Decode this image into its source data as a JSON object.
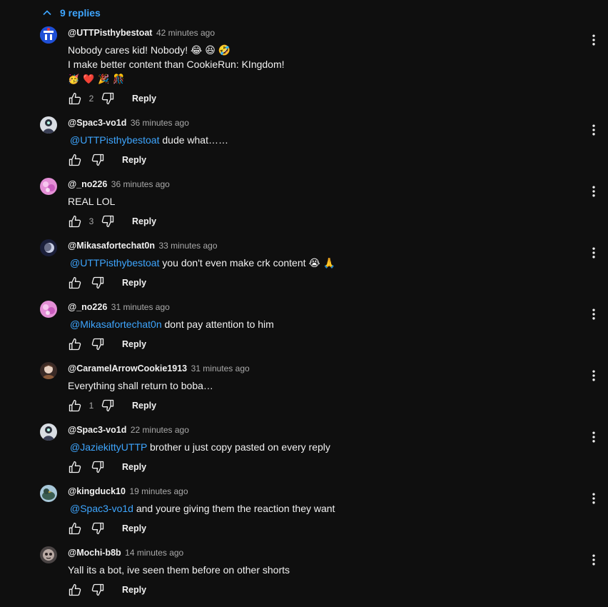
{
  "replies_toggle": {
    "label": "9 replies"
  },
  "comments": [
    {
      "author": "@UTTPisthybestoat",
      "time": "42 minutes ago",
      "lines": [
        "Nobody cares kid! Nobody! 😂 😆 🤣",
        "I make better content than CookieRun: KIngdom!"
      ],
      "emojis": [
        "🥳",
        "❤️",
        "🎉",
        "🎊"
      ],
      "likes": "2",
      "reply_label": "Reply"
    },
    {
      "author": "@Spac3-vo1d",
      "time": "36 minutes ago",
      "mention": "@UTTPisthybestoat",
      "text": "dude what……",
      "likes": "",
      "reply_label": "Reply"
    },
    {
      "author": "@_no226",
      "time": "36 minutes ago",
      "text": "REAL LOL",
      "likes": "3",
      "reply_label": "Reply"
    },
    {
      "author": "@Mikasafortechat0n",
      "time": "33 minutes ago",
      "mention": "@UTTPisthybestoat",
      "text": "you don't even make crk content 😭 🙏",
      "likes": "",
      "reply_label": "Reply"
    },
    {
      "author": "@_no226",
      "time": "31 minutes ago",
      "mention": "@Mikasafortechat0n",
      "text": "dont pay attention to him",
      "likes": "",
      "reply_label": "Reply"
    },
    {
      "author": "@CaramelArrowCookie1913",
      "time": "31 minutes ago",
      "text": "Everything shall return to boba…",
      "likes": "1",
      "reply_label": "Reply"
    },
    {
      "author": "@Spac3-vo1d",
      "time": "22 minutes ago",
      "mention": "@JaziekittyUTTP",
      "text": "brother u just copy pasted on every reply",
      "likes": "",
      "reply_label": "Reply"
    },
    {
      "author": "@kingduck10",
      "time": "19 minutes ago",
      "mention": "@Spac3-vo1d",
      "text": " and youre giving them the reaction they want",
      "likes": "",
      "reply_label": "Reply"
    },
    {
      "author": "@Mochi-b8b",
      "time": "14 minutes ago",
      "text": "Yall its a bot, ive seen them before on other shorts",
      "likes": "",
      "reply_label": "Reply"
    }
  ]
}
